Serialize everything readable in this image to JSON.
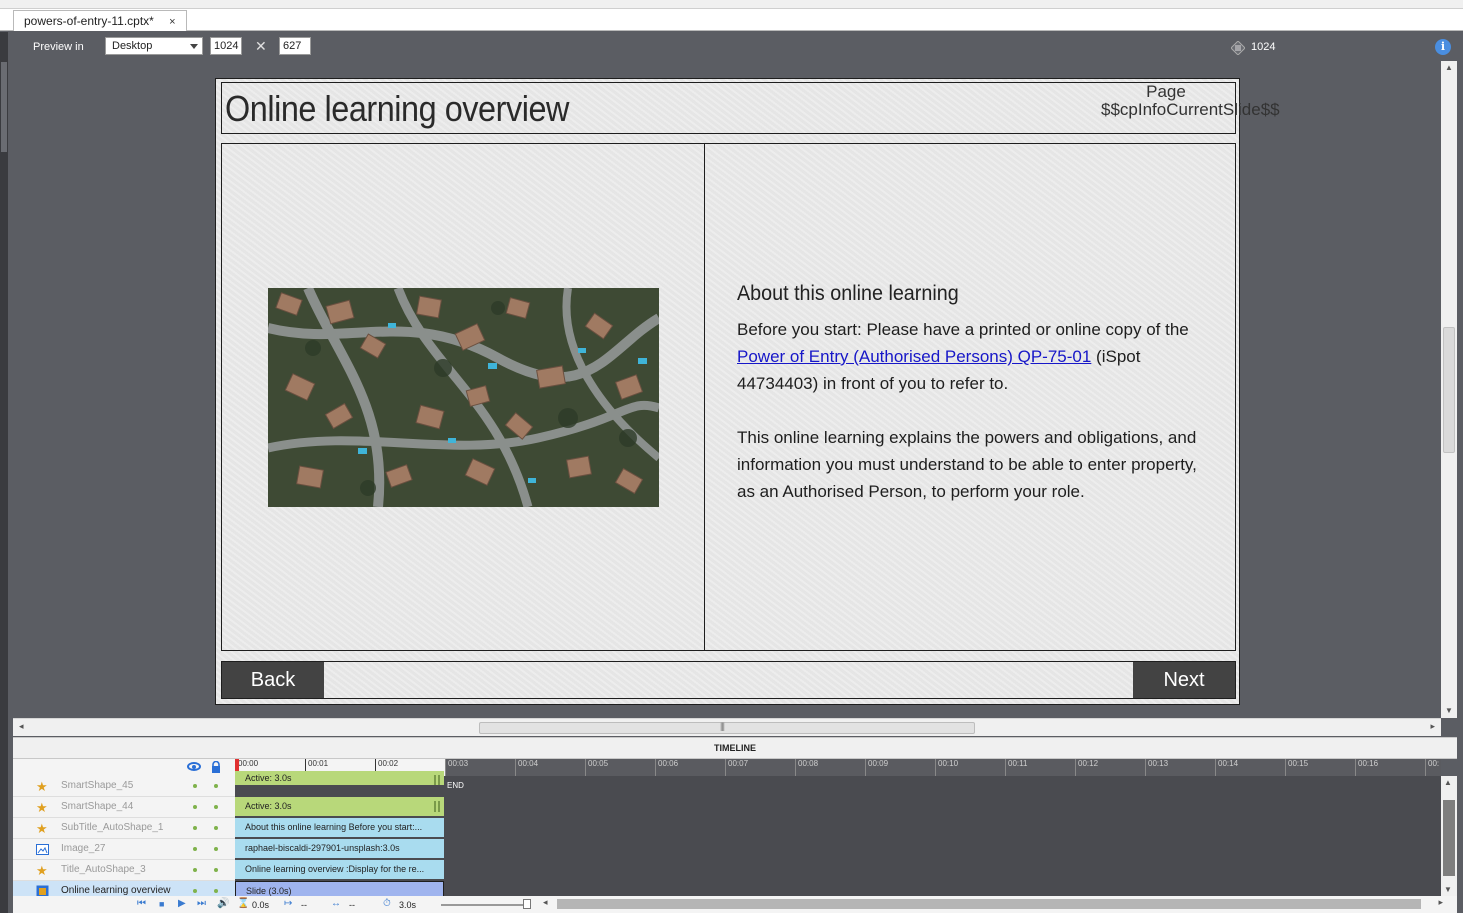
{
  "tab": {
    "title": "powers-of-entry-11.cptx*",
    "close": "×"
  },
  "preview": {
    "label": "Preview in",
    "device": "Desktop",
    "width": "1024",
    "height": "627",
    "ruler_value": "1024"
  },
  "slide": {
    "title": "Online learning overview",
    "page_label": "Page $$cpInfoCurrentSlide$$",
    "subtitle": "About this online learning",
    "para1_bold": "Before you start:",
    "para1_a": " Please have a printed or online copy of the ",
    "para1_link": "Power of Entry (Authorised Persons) QP-75-01",
    "para1_b": " (iSpot 44734403) in front of you to refer to.",
    "para2": "This online learning explains the powers and obligations, and information you must understand to be able to enter property, as an Authorised Person, to perform your role.",
    "back_label": "Back",
    "next_label": "Next"
  },
  "timeline": {
    "header": "TIMELINE",
    "rows": [
      {
        "name": "SmartShape_45",
        "icon": "star-icon",
        "bar": "Active: 3.0s",
        "bar_type": "green"
      },
      {
        "name": "SmartShape_44",
        "icon": "star-icon",
        "bar": "Active: 3.0s",
        "bar_type": "green"
      },
      {
        "name": "SubTitle_AutoShape_1",
        "icon": "star-icon",
        "bar": "About this online learning  Before you start:...",
        "bar_type": "blue"
      },
      {
        "name": "Image_27",
        "icon": "image-icon",
        "bar": "raphael-biscaldi-297901-unsplash:3.0s",
        "bar_type": "blue"
      },
      {
        "name": "Title_AutoShape_3",
        "icon": "star-icon",
        "bar": "Online learning overview :Display for the re...",
        "bar_type": "blue"
      },
      {
        "name": "Online learning overview",
        "icon": "slide-icon",
        "bar": "Slide (3.0s)",
        "bar_type": "slide"
      }
    ],
    "ticks": [
      "00:00",
      "00:01",
      "00:02",
      "00:03",
      "00:04",
      "00:05",
      "00:06",
      "00:07",
      "00:08",
      "00:09",
      "00:10",
      "00:11",
      "00:12",
      "00:13",
      "00:14",
      "00:15",
      "00:16",
      "00:"
    ],
    "end_label": "END",
    "current_time": "0.0s",
    "start_time": "--",
    "duration_marker": "--",
    "total_duration": "3.0s"
  }
}
